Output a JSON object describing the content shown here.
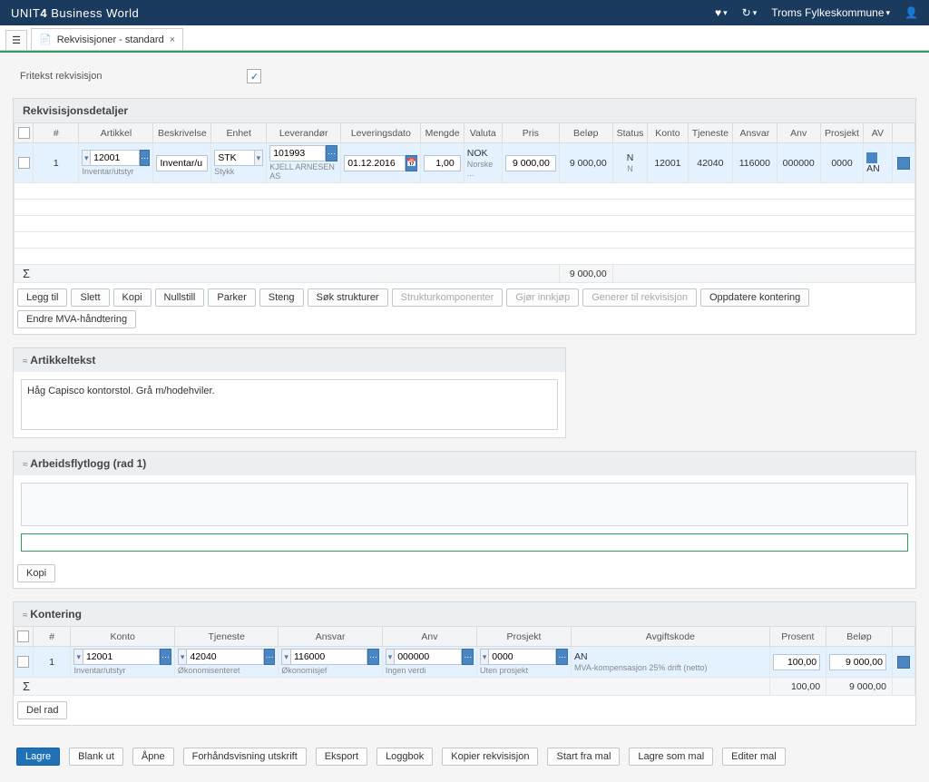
{
  "topbar": {
    "brand_prefix": "UNIT",
    "brand_num": "4",
    "brand_suffix": "Business World",
    "org_name": "Troms Fylkeskommune"
  },
  "tab": {
    "title": "Rekvisisjoner - standard"
  },
  "freetext": {
    "label": "Fritekst rekvisisjon"
  },
  "details_grid": {
    "title": "Rekvisisjonsdetaljer",
    "headers": {
      "num": "#",
      "artikkel": "Artikkel",
      "beskrivelse": "Beskrivelse",
      "enhet": "Enhet",
      "leverandor": "Leverandør",
      "leveringsdato": "Leveringsdato",
      "mengde": "Mengde",
      "valuta": "Valuta",
      "pris": "Pris",
      "belop": "Beløp",
      "status": "Status",
      "konto": "Konto",
      "tjeneste": "Tjeneste",
      "ansvar": "Ansvar",
      "anv": "Anv",
      "prosjekt": "Prosjekt",
      "av": "AV"
    },
    "row": {
      "num": "1",
      "artikkel": "12001",
      "artikkel_sub": "Inventar/utstyr",
      "beskrivelse": "Inventar/u",
      "enhet": "STK",
      "enhet_sub": "Stykk",
      "leverandor": "101993",
      "leverandor_sub": "KJELL ARNESEN AS",
      "leveringsdato": "01.12.2016",
      "mengde": "1,00",
      "valuta": "NOK",
      "valuta_sub": "Norske ...",
      "pris": "9 000,00",
      "belop": "9 000,00",
      "status": "N",
      "status_sub": "N",
      "konto": "12001",
      "tjeneste": "42040",
      "ansvar": "116000",
      "anv": "000000",
      "prosjekt": "0000",
      "av": "AN"
    },
    "total_belop": "9 000,00",
    "buttons": {
      "legg_til": "Legg til",
      "slett": "Slett",
      "kopi": "Kopi",
      "nullstill": "Nullstill",
      "parker": "Parker",
      "steng": "Steng",
      "sok_strukturer": "Søk strukturer",
      "strukturkomponenter": "Strukturkomponenter",
      "gjor_innkjop": "Gjør innkjøp",
      "generer_til_rekvisisjon": "Generer til rekvisisjon",
      "oppdatere_kontering": "Oppdatere kontering",
      "endre_mva": "Endre MVA-håndtering"
    }
  },
  "artikkeltekst": {
    "title": "Artikkeltekst",
    "value": "Håg Capisco kontorstol. Grå m/hodehviler."
  },
  "workflow": {
    "title": "Arbeidsflytlogg (rad 1)",
    "kopi": "Kopi"
  },
  "kontering": {
    "title": "Kontering",
    "headers": {
      "num": "#",
      "konto": "Konto",
      "tjeneste": "Tjeneste",
      "ansvar": "Ansvar",
      "anv": "Anv",
      "prosjekt": "Prosjekt",
      "avgiftskode": "Avgiftskode",
      "prosent": "Prosent",
      "belop": "Beløp"
    },
    "row": {
      "num": "1",
      "konto": "12001",
      "konto_sub": "Inventar/utstyr",
      "tjeneste": "42040",
      "tjeneste_sub": "Økonomisenteret",
      "ansvar": "116000",
      "ansvar_sub": "Økonomisjef",
      "anv": "000000",
      "anv_sub": "Ingen verdi",
      "prosjekt": "0000",
      "prosjekt_sub": "Uten prosjekt",
      "avgiftskode": "AN",
      "avgiftskode_sub": "MVA-kompensasjon 25% drift (netto)",
      "prosent": "100,00",
      "belop": "9 000,00"
    },
    "totals": {
      "prosent": "100,00",
      "belop": "9 000,00"
    },
    "del_rad": "Del rad"
  },
  "footer": {
    "lagre": "Lagre",
    "blank_ut": "Blank ut",
    "apne": "Åpne",
    "forhand": "Forhåndsvisning utskrift",
    "eksport": "Eksport",
    "loggbok": "Loggbok",
    "kopier": "Kopier rekvisisjon",
    "start_mal": "Start fra mal",
    "lagre_mal": "Lagre som mal",
    "editer_mal": "Editer mal"
  }
}
